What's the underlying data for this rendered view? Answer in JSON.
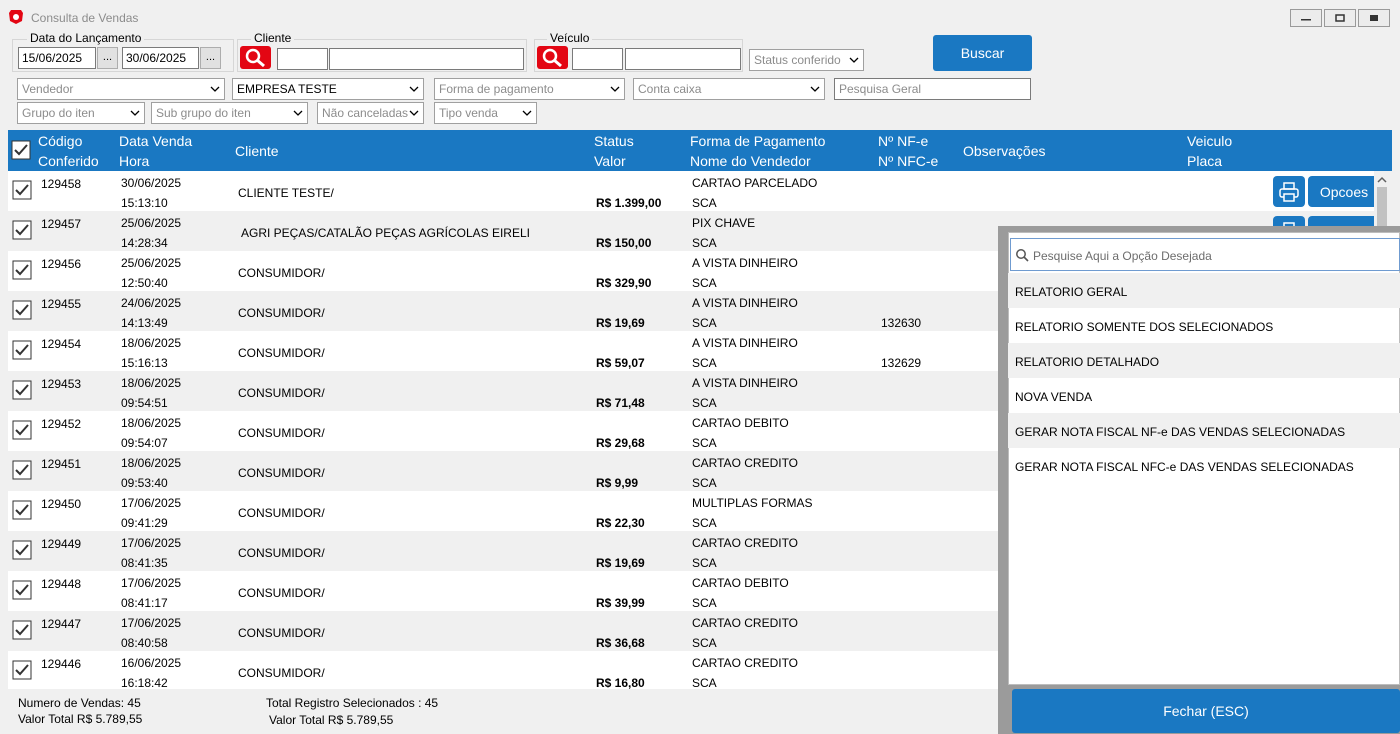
{
  "window": {
    "title": "Consulta de Vendas"
  },
  "filters": {
    "data_lancamento_label": "Data do Lançamento",
    "data_inicio": "15/06/2025",
    "data_fim": "30/06/2025",
    "date_picker_label": "...",
    "cliente_label": "Cliente",
    "veiculo_label": "Veículo",
    "status_conferido": "Status conferido",
    "buscar_label": "Buscar",
    "vendedor": "Vendedor",
    "empresa": "EMPRESA TESTE",
    "forma_pagamento": "Forma de pagamento",
    "conta_caixa": "Conta caixa",
    "pesquisa_geral": "Pesquisa Geral",
    "grupo_item": "Grupo do iten",
    "sub_grupo_item": "Sub grupo do iten",
    "nao_canceladas": "Não canceladas",
    "tipo_venda": "Tipo venda"
  },
  "table": {
    "headers": {
      "codigo": "Código",
      "conferido": "Conferido",
      "data_venda": "Data Venda",
      "hora": "Hora",
      "cliente": "Cliente",
      "status": "Status",
      "valor": "Valor",
      "forma_pagamento": "Forma de Pagamento",
      "nome_vendedor": "Nome do Vendedor",
      "nf_e": "Nº NF-e",
      "nfc_e": "Nº NFC-e",
      "observacoes": "Observações",
      "veiculo": "Veiculo",
      "placa": "Placa"
    },
    "opcoes_label": "Opcoes",
    "rows": [
      {
        "codigo": "129458",
        "data": "30/06/2025",
        "hora": "15:13:10",
        "cliente": "CLIENTE TESTE/",
        "valor": "R$ 1.399,00",
        "forma": "CARTAO PARCELADO",
        "vendedor": "SCA",
        "nfce": ""
      },
      {
        "codigo": "129457",
        "data": "25/06/2025",
        "hora": "14:28:34",
        "cliente": "AGRI PEÇAS/CATALÃO PEÇAS AGRÍCOLAS EIRELI",
        "valor": "R$ 150,00",
        "forma": "PIX CHAVE",
        "vendedor": "SCA",
        "nfce": ""
      },
      {
        "codigo": "129456",
        "data": "25/06/2025",
        "hora": "12:50:40",
        "cliente": "CONSUMIDOR/",
        "valor": "R$ 329,90",
        "forma": "A VISTA DINHEIRO",
        "vendedor": "SCA",
        "nfce": ""
      },
      {
        "codigo": "129455",
        "data": "24/06/2025",
        "hora": "14:13:49",
        "cliente": "CONSUMIDOR/",
        "valor": "R$ 19,69",
        "forma": "A VISTA DINHEIRO",
        "vendedor": "SCA",
        "nfce": "132630"
      },
      {
        "codigo": "129454",
        "data": "18/06/2025",
        "hora": "15:16:13",
        "cliente": "CONSUMIDOR/",
        "valor": "R$ 59,07",
        "forma": "A VISTA DINHEIRO",
        "vendedor": "SCA",
        "nfce": "132629"
      },
      {
        "codigo": "129453",
        "data": "18/06/2025",
        "hora": "09:54:51",
        "cliente": "CONSUMIDOR/",
        "valor": "R$ 71,48",
        "forma": "A VISTA DINHEIRO",
        "vendedor": "SCA",
        "nfce": ""
      },
      {
        "codigo": "129452",
        "data": "18/06/2025",
        "hora": "09:54:07",
        "cliente": "CONSUMIDOR/",
        "valor": "R$ 29,68",
        "forma": "CARTAO DEBITO",
        "vendedor": "SCA",
        "nfce": ""
      },
      {
        "codigo": "129451",
        "data": "18/06/2025",
        "hora": "09:53:40",
        "cliente": "CONSUMIDOR/",
        "valor": "R$ 9,99",
        "forma": "CARTAO CREDITO",
        "vendedor": "SCA",
        "nfce": ""
      },
      {
        "codigo": "129450",
        "data": "17/06/2025",
        "hora": "09:41:29",
        "cliente": "CONSUMIDOR/",
        "valor": "R$ 22,30",
        "forma": "MULTIPLAS FORMAS",
        "vendedor": "SCA",
        "nfce": ""
      },
      {
        "codigo": "129449",
        "data": "17/06/2025",
        "hora": "08:41:35",
        "cliente": "CONSUMIDOR/",
        "valor": "R$ 19,69",
        "forma": "CARTAO CREDITO",
        "vendedor": "SCA",
        "nfce": ""
      },
      {
        "codigo": "129448",
        "data": "17/06/2025",
        "hora": "08:41:17",
        "cliente": "CONSUMIDOR/",
        "valor": "R$ 39,99",
        "forma": "CARTAO DEBITO",
        "vendedor": "SCA",
        "nfce": ""
      },
      {
        "codigo": "129447",
        "data": "17/06/2025",
        "hora": "08:40:58",
        "cliente": "CONSUMIDOR/",
        "valor": "R$ 36,68",
        "forma": "CARTAO CREDITO",
        "vendedor": "SCA",
        "nfce": ""
      },
      {
        "codigo": "129446",
        "data": "16/06/2025",
        "hora": "16:18:42",
        "cliente": "CONSUMIDOR/",
        "valor": "R$ 16,80",
        "forma": "CARTAO CREDITO",
        "vendedor": "SCA",
        "nfce": ""
      }
    ]
  },
  "footer": {
    "numero_vendas": "Numero de Vendas: 45",
    "valor_total": "Valor Total R$ 5.789,55",
    "total_selecionados": "Total Registro Selecionados : 45",
    "valor_total_sel": "Valor Total R$ 5.789,55"
  },
  "options_panel": {
    "search_placeholder": "Pesquise Aqui a Opção Desejada",
    "options": [
      "RELATORIO GERAL",
      "RELATORIO SOMENTE DOS SELECIONADOS",
      "RELATORIO DETALHADO",
      "NOVA VENDA",
      "GERAR NOTA FISCAL NF-e DAS VENDAS SELECIONADAS",
      "GERAR NOTA FISCAL NFC-e DAS VENDAS SELECIONADAS"
    ],
    "fechar_label": "Fechar  (ESC)"
  },
  "colors": {
    "accent": "#1a78c2",
    "search_red": "#e30613"
  }
}
